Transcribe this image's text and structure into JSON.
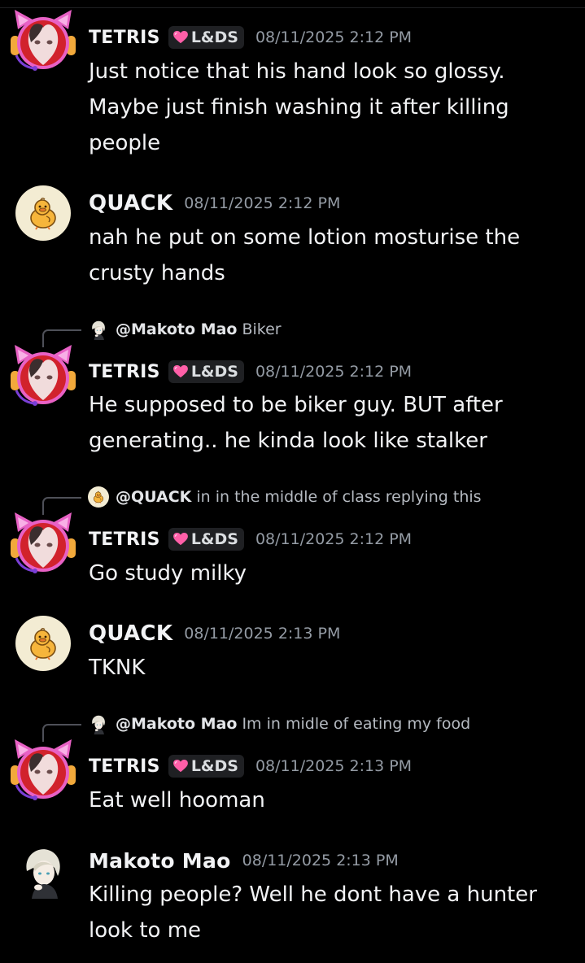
{
  "badges": {
    "tetris_tag_label": "L&DS"
  },
  "colors": {
    "background": "#000000",
    "text": "#f2f3f5",
    "timestamp": "#949ba4",
    "tag_background": "#1f2023",
    "heart": "#ff5fa8",
    "reply_spine": "#4e5058"
  },
  "messages": [
    {
      "author": "TETRIS",
      "tag": "L&DS",
      "timestamp": "08/11/2025 2:12 PM",
      "lines": [
        "Just notice that his hand look so glossy.",
        "Maybe just finish washing it after killing",
        "people"
      ]
    },
    {
      "author": "QUACK",
      "timestamp": "08/11/2025 2:12 PM",
      "lines": [
        "nah he put on some lotion mosturise the",
        "crusty hands"
      ]
    },
    {
      "reply_to": "@Makoto Mao",
      "reply_text": "Biker",
      "author": "TETRIS",
      "tag": "L&DS",
      "timestamp": "08/11/2025 2:12 PM",
      "lines": [
        "He supposed to be biker guy. BUT after",
        "generating.. he kinda look like stalker"
      ]
    },
    {
      "reply_to": "@QUACK",
      "reply_text": "in in the middle of class replying this",
      "author": "TETRIS",
      "tag": "L&DS",
      "timestamp": "08/11/2025 2:12 PM",
      "lines": [
        "Go study milky"
      ]
    },
    {
      "author": "QUACK",
      "timestamp": "08/11/2025 2:13 PM",
      "lines": [
        "TKNK"
      ]
    },
    {
      "reply_to": "@Makoto Mao",
      "reply_text": "Im in midle of eating my food",
      "author": "TETRIS",
      "tag": "L&DS",
      "timestamp": "08/11/2025 2:13 PM",
      "lines": [
        "Eat well hooman"
      ]
    },
    {
      "author": "Makoto Mao",
      "timestamp": "08/11/2025 2:13 PM",
      "lines": [
        "Killing people? Well he dont have a hunter",
        "look to me"
      ]
    }
  ]
}
